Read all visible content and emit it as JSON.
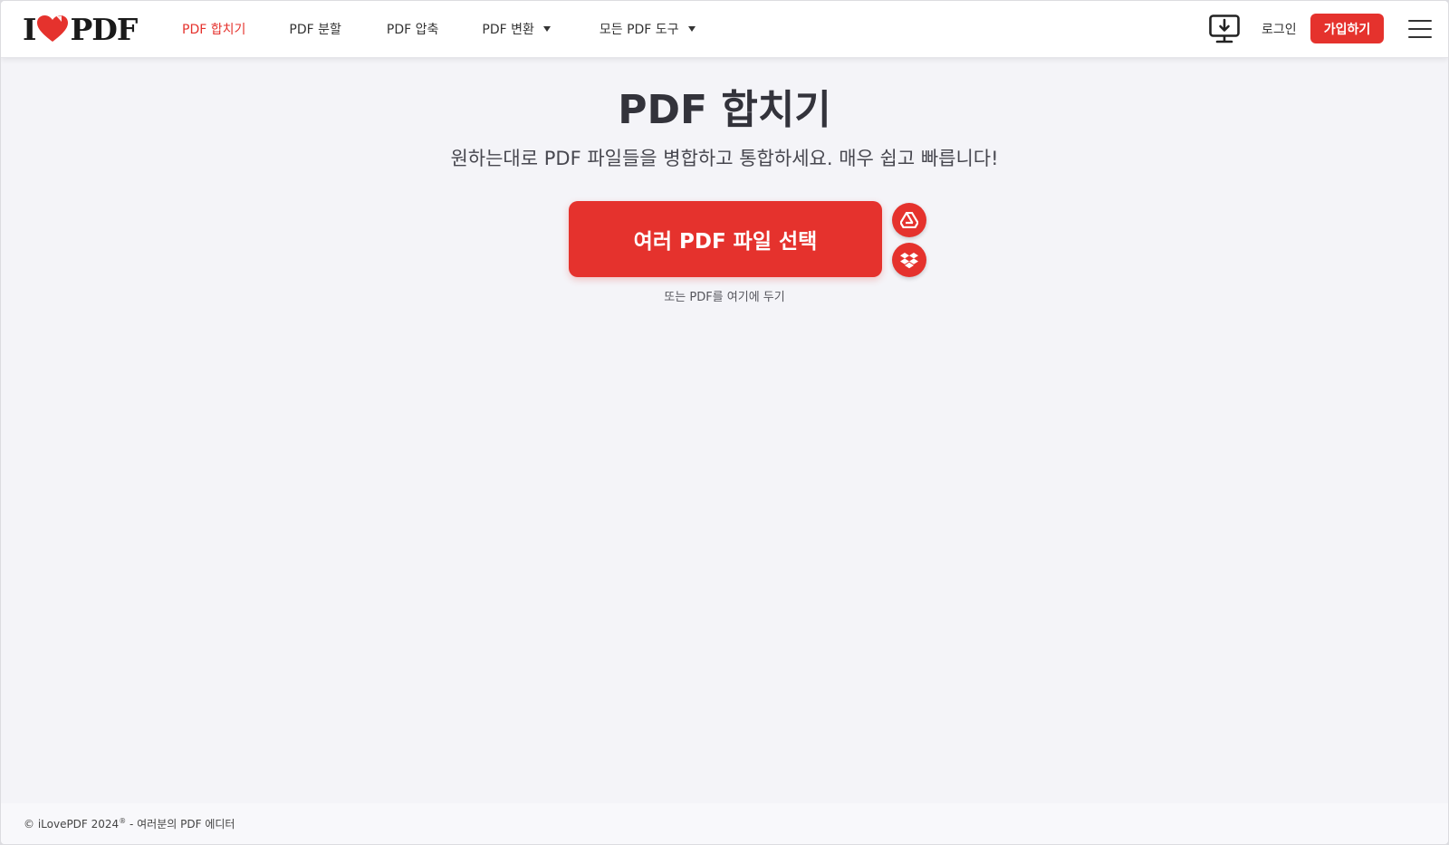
{
  "header": {
    "logo": {
      "left": "I",
      "right": "PDF",
      "heart_color": "#e5322d"
    },
    "nav": [
      {
        "label": "PDF 합치기",
        "active": true,
        "dropdown": false
      },
      {
        "label": "PDF 분할",
        "active": false,
        "dropdown": false
      },
      {
        "label": "PDF 압축",
        "active": false,
        "dropdown": false
      },
      {
        "label": "PDF 변환",
        "active": false,
        "dropdown": true
      },
      {
        "label": "모든 PDF 도구",
        "active": false,
        "dropdown": true
      }
    ],
    "desktop_icon": "desktop-download-icon",
    "login_label": "로그인",
    "signup_label": "가입하기",
    "menu_icon": "hamburger-menu-icon"
  },
  "main": {
    "title": "PDF 합치기",
    "subtitle": "원하는대로 PDF 파일들을 병합하고 통합하세요. 매우 쉽고 빠릅니다!",
    "select_button_label": "여러 PDF 파일 선택",
    "cloud_buttons": [
      {
        "icon": "google-drive-icon"
      },
      {
        "icon": "dropbox-icon"
      }
    ],
    "drop_hint": "또는 PDF를 여기에 두기"
  },
  "footer": {
    "copyright": "© iLovePDF 2024",
    "registered_mark": "®",
    "tagline": " - 여러분의 PDF 에디터"
  },
  "colors": {
    "accent": "#e5322d",
    "background": "#f4f4f8",
    "header_bg": "#ffffff",
    "text_dark": "#33333b"
  }
}
